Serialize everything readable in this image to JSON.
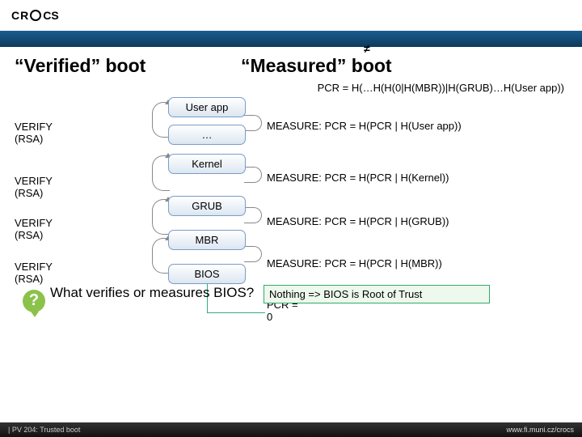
{
  "logo": {
    "c": "C",
    "r": "R",
    "cs": "CS"
  },
  "titles": {
    "left": "“Verified” boot",
    "right": "“Measured” boot"
  },
  "pcr_formula": "PCR = H(…H(H(0|H(MBR))|H(GRUB)…H(User app))",
  "neq": "≠",
  "stack": {
    "userapp": "User app",
    "dots": "…",
    "kernel": "Kernel",
    "grub": "GRUB",
    "mbr": "MBR",
    "bios": "BIOS"
  },
  "verify": {
    "v1": "VERIFY (RSA)",
    "v2": "VERIFY (RSA)",
    "v3": "VERIFY (RSA)",
    "v4": "VERIFY (RSA)"
  },
  "measure": {
    "m1": "MEASURE: PCR = H(PCR | H(User app))",
    "m2": "MEASURE: PCR = H(PCR | H(Kernel))",
    "m3": "MEASURE: PCR = H(PCR | H(GRUB))",
    "m4": "MEASURE: PCR = H(PCR | H(MBR))",
    "reset": "RESET: PCR = 0"
  },
  "root_box": "Nothing => BIOS is Root of Trust",
  "question": {
    "icon": "?",
    "text": "What verifies or measures BIOS?"
  },
  "footer": {
    "left": "| PV 204: Trusted boot",
    "right": "www.fi.muni.cz/crocs"
  }
}
